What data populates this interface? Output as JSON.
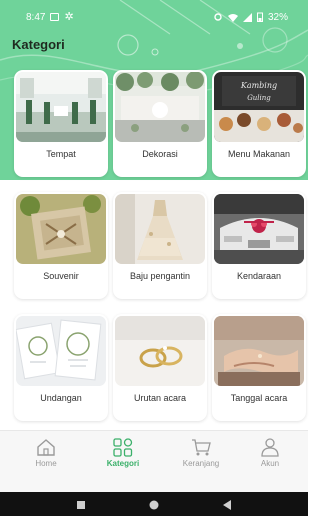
{
  "status_bar": {
    "time": "8:47",
    "battery": "32%"
  },
  "page": {
    "title": "Kategori"
  },
  "categories": [
    {
      "label": "Tempat",
      "icon": "venue-hall-photo"
    },
    {
      "label": "Dekorasi",
      "icon": "decoration-photo"
    },
    {
      "label": "Menu Makanan",
      "icon": "food-menu-photo"
    },
    {
      "label": "Souvenir",
      "icon": "souvenir-photo"
    },
    {
      "label": "Baju pengantin",
      "icon": "wedding-dress-photo"
    },
    {
      "label": "Kendaraan",
      "icon": "wedding-car-photo"
    },
    {
      "label": "Undangan",
      "icon": "invitation-photo"
    },
    {
      "label": "Urutan acara",
      "icon": "rings-photo"
    },
    {
      "label": "Tanggal acara",
      "icon": "hands-photo"
    }
  ],
  "bottom_nav": {
    "items": [
      {
        "label": "Home",
        "icon": "home-icon",
        "active": false
      },
      {
        "label": "Kategori",
        "icon": "grid-icon",
        "active": true
      },
      {
        "label": "Keranjang",
        "icon": "cart-icon",
        "active": false
      },
      {
        "label": "Akun",
        "icon": "user-icon",
        "active": false
      }
    ]
  },
  "colors": {
    "header_green": "#6fd39a",
    "active_nav": "#3bb06a",
    "inactive_nav": "#9a9a9a"
  }
}
